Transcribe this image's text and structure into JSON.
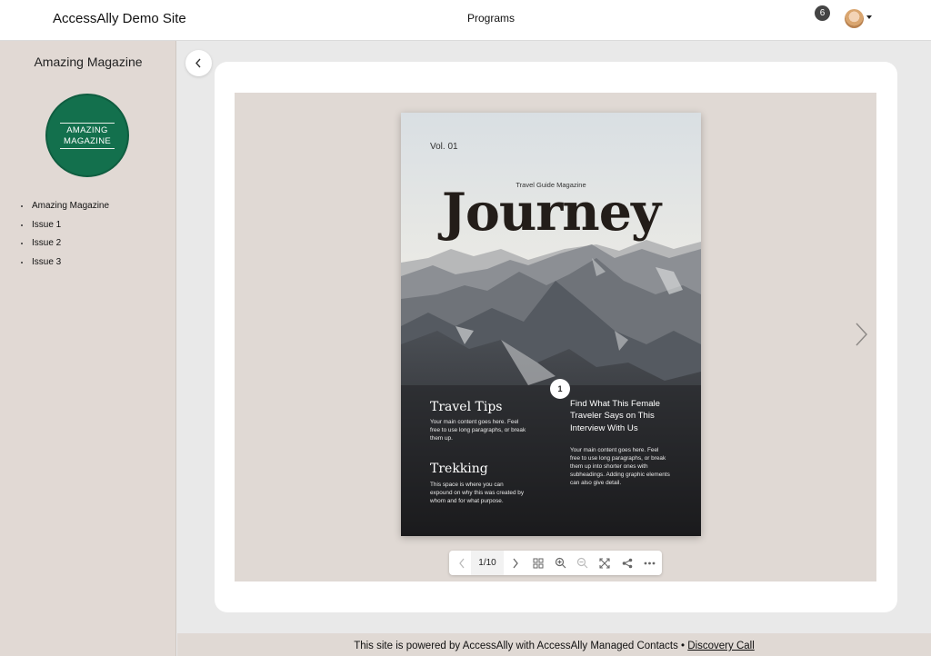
{
  "header": {
    "site_title": "AccessAlly Demo Site",
    "nav_programs": "Programs",
    "notification_count": "6"
  },
  "sidebar": {
    "title": "Amazing Magazine",
    "logo_line1": "AMAZING",
    "logo_line2": "MAGAZINE",
    "items": [
      {
        "label": "Amazing Magazine"
      },
      {
        "label": "Issue 1"
      },
      {
        "label": "Issue 2"
      },
      {
        "label": "Issue 3"
      }
    ]
  },
  "magazine": {
    "vol": "Vol. 01",
    "subtitle": "Travel Guide Magazine",
    "headline": "Journey",
    "number": "1",
    "tips_title": "Travel Tips",
    "tips_body": "Your main content goes here. Feel free to use long paragraphs, or break them up.",
    "trek_title": "Trekking",
    "trek_body": "This space is where you can expound on why this was created by whom and for what purpose.",
    "right_title": "Find What This Female Traveler Says on This Interview With Us",
    "right_body": "Your main content goes here. Feel free to use long paragraphs, or break them up into shorter ones with subheadings. Adding graphic elements can also give detail."
  },
  "toolbar": {
    "page_indicator": "1/10"
  },
  "footer": {
    "text": "This site is powered by AccessAlly with AccessAlly Managed Contacts •",
    "link": "Discovery Call"
  }
}
